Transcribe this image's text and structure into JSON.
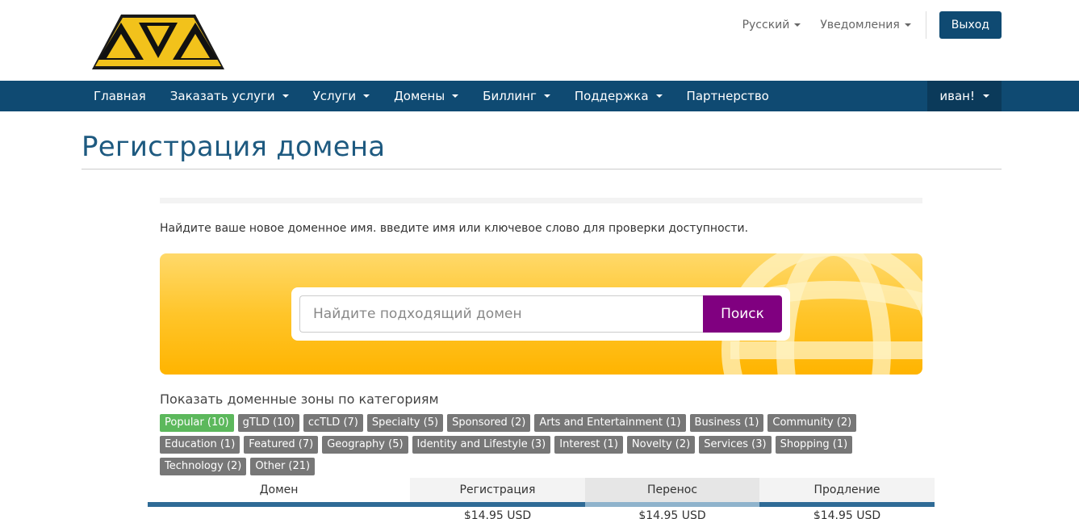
{
  "header": {
    "language_label": "Русский",
    "notifications_label": "Уведомления",
    "logout_label": "Выход",
    "logo_text": "AVA"
  },
  "nav": {
    "items": [
      {
        "label": "Главная",
        "dropdown": false
      },
      {
        "label": "Заказать услуги",
        "dropdown": true
      },
      {
        "label": "Услуги",
        "dropdown": true
      },
      {
        "label": "Домены",
        "dropdown": true
      },
      {
        "label": "Биллинг",
        "dropdown": true
      },
      {
        "label": "Поддержка",
        "dropdown": true
      },
      {
        "label": "Партнерство",
        "dropdown": false
      }
    ],
    "user_label": "иван!"
  },
  "page": {
    "title": "Регистрация домена",
    "intro": "Найдите ваше новое доменное имя. введите имя или ключевое слово для проверки доступности."
  },
  "search": {
    "placeholder": "Найдите подходящий домен",
    "button_label": "Поиск"
  },
  "categories": {
    "heading": "Показать доменные зоны по категориям",
    "tags": [
      {
        "label": "Popular (10)",
        "active": true
      },
      {
        "label": "gTLD (10)",
        "active": false
      },
      {
        "label": "ccTLD (7)",
        "active": false
      },
      {
        "label": "Specialty (5)",
        "active": false
      },
      {
        "label": "Sponsored (2)",
        "active": false
      },
      {
        "label": "Arts and Entertainment (1)",
        "active": false
      },
      {
        "label": "Business (1)",
        "active": false
      },
      {
        "label": "Community (2)",
        "active": false
      },
      {
        "label": "Education (1)",
        "active": false
      },
      {
        "label": "Featured (7)",
        "active": false
      },
      {
        "label": "Geography (5)",
        "active": false
      },
      {
        "label": "Identity and Lifestyle (3)",
        "active": false
      },
      {
        "label": "Interest (1)",
        "active": false
      },
      {
        "label": "Novelty (2)",
        "active": false
      },
      {
        "label": "Services (3)",
        "active": false
      },
      {
        "label": "Shopping (1)",
        "active": false
      },
      {
        "label": "Technology (2)",
        "active": false
      },
      {
        "label": "Other (21)",
        "active": false
      }
    ]
  },
  "pricing": {
    "headers": [
      "Домен",
      "Регистрация",
      "Перенос",
      "Продление"
    ],
    "rows": [
      {
        "domain": "",
        "register": "$14.95 USD",
        "transfer": "$14.95 USD",
        "renew": "$14.95 USD"
      }
    ]
  },
  "colors": {
    "brand_blue": "#0f4a72",
    "search_button": "#800080",
    "active_tag": "#5cb85c",
    "tag": "#777777",
    "banner_yellow": "#ffc52a"
  },
  "icons": [
    "globe-icon",
    "chevron-down-icon"
  ]
}
